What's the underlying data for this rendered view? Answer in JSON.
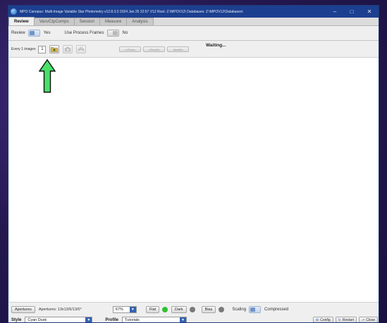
{
  "titlebar": {
    "title": "MPO Canopus: Multi-Image Variable Star Photometry  v12.8.3.0  2024 Jan 25  22:57    V12 Root: Z:\\MPOV12\\   Databases: Z:\\MPOV12\\Databases\\",
    "minimize": "–",
    "maximize": "□",
    "close": "✕"
  },
  "tabs": [
    {
      "label": "Review",
      "active": true
    },
    {
      "label": "Vars/CtpComps",
      "active": false
    },
    {
      "label": "Session",
      "active": false
    },
    {
      "label": "Measure",
      "active": false
    },
    {
      "label": "Analysis",
      "active": false
    }
  ],
  "options": {
    "review_label": "Review",
    "review_value": "Yes",
    "process_frames_label": "Use Process Frames",
    "process_frames_value": "No"
  },
  "toolbar": {
    "every_label": "Every 1 images",
    "every_value": "1",
    "nav_buttons": [
      "<<First>>",
      "<Prev/N>",
      "Next/N>"
    ],
    "status": "Waiting..."
  },
  "bottom": {
    "apertures_button": "Apertures",
    "apertures_text": "Apertures: 13x13/5/13/0°",
    "zoom_value": "67%",
    "flat_label": "Flat",
    "dark_label": "Dark",
    "bias_label": "Bias",
    "scaling_label": "Scaling",
    "scaling_value": "Compressed",
    "style_label": "Style",
    "style_value": "Cyan Dusk",
    "profile_label": "Profile",
    "profile_value": "Tutorials",
    "config_button": "Config",
    "restart_button": "Restart",
    "close_button": "Close"
  },
  "colors": {
    "titlebar": "#1c3f8f",
    "flat_indicator": "#2fc22f",
    "dark_indicator": "#7a7a7a",
    "bias_indicator": "#7a7a7a",
    "arrow_fill": "#49e06a"
  }
}
